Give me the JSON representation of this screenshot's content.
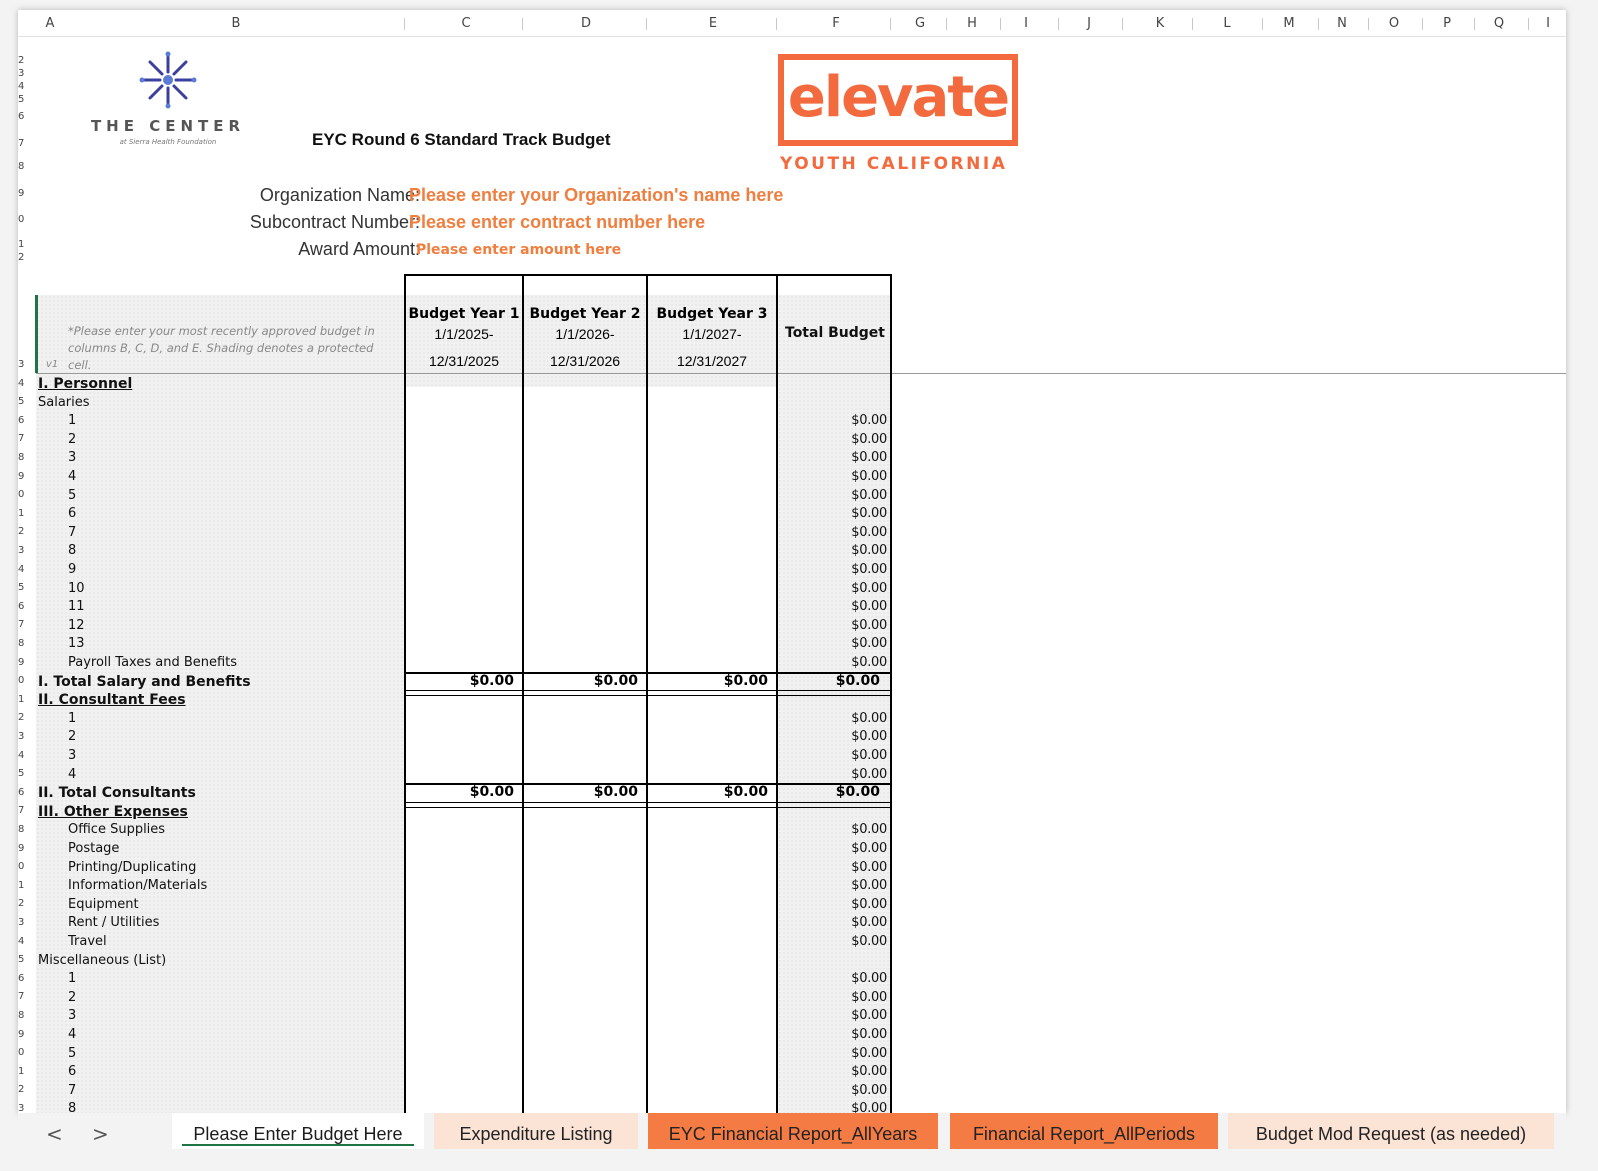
{
  "column_headers": [
    "A",
    "B",
    "C",
    "D",
    "E",
    "F",
    "G",
    "H",
    "I",
    "J",
    "K",
    "L",
    "M",
    "N",
    "O",
    "P",
    "Q",
    "I"
  ],
  "logo_center": {
    "title": "THE CENTER",
    "subtitle": "at Sierra Health Foundation"
  },
  "logo_elevate": {
    "word": "elevate",
    "subtitle": "YOUTH CALIFORNIA"
  },
  "budget_title": "EYC Round 6 Standard Track Budget",
  "org": {
    "label": "Organization Name:",
    "placeholder": "Please enter your Organization's name here"
  },
  "contract": {
    "label": "Subcontract Number:",
    "placeholder": "Please enter contract number here"
  },
  "award": {
    "label": "Award Amount:",
    "placeholder": "Please enter amount here"
  },
  "instructions": "*Please enter your most recently approved budget in columns B, C, D, and E. Shading denotes a protected cell.",
  "row_tag": "v1",
  "headers": {
    "year1": {
      "title": "Budget Year 1",
      "start": "1/1/2025-",
      "end": "12/31/2025"
    },
    "year2": {
      "title": "Budget Year 2",
      "start": "1/1/2026-",
      "end": "12/31/2026"
    },
    "year3": {
      "title": "Budget Year 3",
      "start": "1/1/2027-",
      "end": "12/31/2027"
    },
    "total": "Total Budget"
  },
  "rows": {
    "personnel": "I.  Personnel",
    "salaries": "Salaries",
    "salary_items": [
      "1",
      "2",
      "3",
      "4",
      "5",
      "6",
      "7",
      "8",
      "9",
      "10",
      "11",
      "12",
      "13"
    ],
    "payroll": "Payroll Taxes and Benefits",
    "total_salary": "I. Total Salary and Benefits",
    "consultant": "II. Consultant Fees",
    "consultant_items": [
      "1",
      "2",
      "3",
      "4"
    ],
    "total_consultants": "II. Total Consultants",
    "other": "III.  Other Expenses",
    "other_items": [
      "Office Supplies",
      "Postage",
      "Printing/Duplicating",
      "Information/Materials",
      "Equipment",
      "Rent / Utilities",
      "Travel"
    ],
    "misc": "Miscellaneous (List)",
    "misc_items": [
      "1",
      "2",
      "3",
      "4",
      "5",
      "6",
      "7",
      "8"
    ]
  },
  "row_numbers_top": [
    "2",
    "3",
    "4",
    "5",
    "6",
    "7",
    "8",
    "9",
    "0",
    "1",
    "2"
  ],
  "row_numbers": [
    "3",
    "4",
    "5",
    "6",
    "7",
    "8",
    "9",
    "0",
    "1",
    "2",
    "3",
    "4",
    "5",
    "6",
    "7",
    "8",
    "9",
    "0",
    "1",
    "2",
    "3",
    "4",
    "5",
    "6",
    "7",
    "8",
    "9",
    "0",
    "1",
    "2",
    "3",
    "4",
    "5",
    "6",
    "7",
    "8",
    "9",
    "0",
    "1",
    "2",
    "3"
  ],
  "zero": "$0.00",
  "tabs": {
    "prev": "<",
    "next": ">",
    "items": [
      "Please Enter Budget Here",
      "Expenditure Listing",
      "EYC Financial Report_AllYears",
      "Financial Report_AllPeriods",
      "Budget Mod Request (as needed)"
    ]
  },
  "colors": {
    "accent": "#f26a3d",
    "accent_text": "#ef7e3f",
    "logo_blue": "#3b3f9e",
    "tab_orange": "#f47c44",
    "tab_peach": "#fbe3d6",
    "active_tab_line": "#217346"
  }
}
